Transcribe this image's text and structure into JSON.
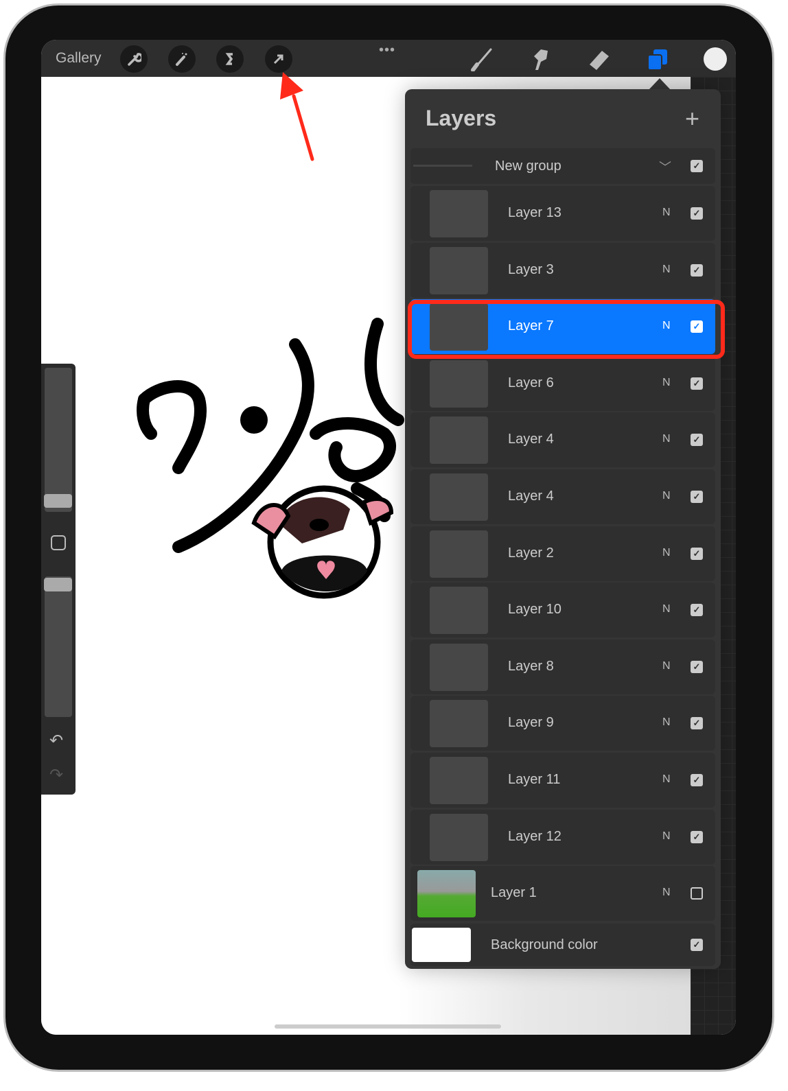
{
  "toolbar": {
    "gallery": "Gallery",
    "tools_left": [
      "wrench-icon",
      "magic-wand-icon",
      "selection-icon",
      "move-arrow-icon"
    ],
    "more": "•••",
    "tools_right": [
      "brush-icon",
      "smudge-icon",
      "eraser-icon",
      "layers-icon"
    ],
    "current_color": "#eeeeee",
    "active_color": "#0a6ff0"
  },
  "layers_panel": {
    "title": "Layers",
    "add": "+",
    "group": {
      "name": "New group",
      "visible": true
    },
    "layers": [
      {
        "name": "Layer 13",
        "mode": "N",
        "visible": true,
        "selected": false
      },
      {
        "name": "Layer 3",
        "mode": "N",
        "visible": true,
        "selected": false
      },
      {
        "name": "Layer 7",
        "mode": "N",
        "visible": true,
        "selected": true
      },
      {
        "name": "Layer 6",
        "mode": "N",
        "visible": true,
        "selected": false
      },
      {
        "name": "Layer 4",
        "mode": "N",
        "visible": true,
        "selected": false
      },
      {
        "name": "Layer 4",
        "mode": "N",
        "visible": true,
        "selected": false
      },
      {
        "name": "Layer 2",
        "mode": "N",
        "visible": true,
        "selected": false
      },
      {
        "name": "Layer 10",
        "mode": "N",
        "visible": true,
        "selected": false
      },
      {
        "name": "Layer 8",
        "mode": "N",
        "visible": true,
        "selected": false
      },
      {
        "name": "Layer 9",
        "mode": "N",
        "visible": true,
        "selected": false
      },
      {
        "name": "Layer 11",
        "mode": "N",
        "visible": true,
        "selected": false
      },
      {
        "name": "Layer 12",
        "mode": "N",
        "visible": true,
        "selected": false
      }
    ],
    "layer1": {
      "name": "Layer 1",
      "mode": "N",
      "visible": false
    },
    "background": {
      "name": "Background color",
      "visible": true
    },
    "selected_color": "#0a78ff"
  },
  "annotation": {
    "color": "#ff2a1a"
  }
}
